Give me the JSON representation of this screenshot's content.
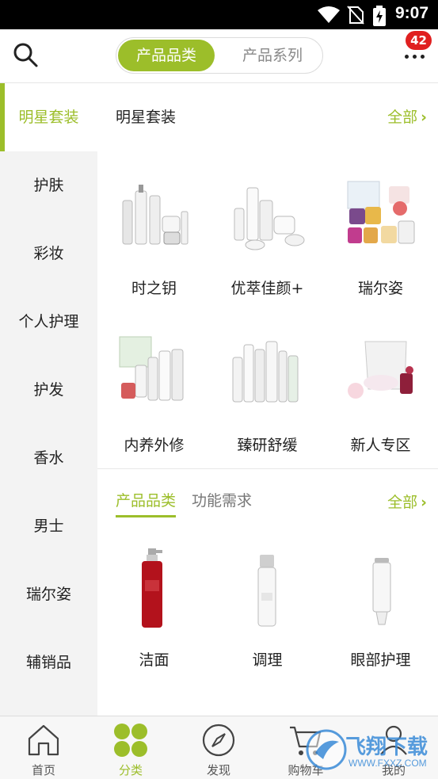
{
  "status_bar": {
    "time": "9:07"
  },
  "header": {
    "segments": {
      "active": "产品品类",
      "inactive": "产品系列"
    },
    "badge_count": "42"
  },
  "sidebar": {
    "items": [
      {
        "label": "明星套装",
        "active": true
      },
      {
        "label": "护肤"
      },
      {
        "label": "彩妆"
      },
      {
        "label": "个人护理"
      },
      {
        "label": "护发"
      },
      {
        "label": "香水"
      },
      {
        "label": "男士"
      },
      {
        "label": "瑞尔姿"
      },
      {
        "label": "辅销品"
      }
    ]
  },
  "main": {
    "section1": {
      "title": "明星套装",
      "all_label": "全部",
      "items": [
        {
          "label": "时之钥"
        },
        {
          "label": "优萃佳颜+"
        },
        {
          "label": "瑞尔姿"
        },
        {
          "label": "内养外修"
        },
        {
          "label": "臻研舒缓"
        },
        {
          "label": "新人专区"
        }
      ]
    },
    "section2": {
      "tabs": [
        "产品品类",
        "功能需求"
      ],
      "all_label": "全部",
      "items": [
        {
          "label": "洁面"
        },
        {
          "label": "调理"
        },
        {
          "label": "眼部护理"
        }
      ]
    }
  },
  "bottom_nav": {
    "items": [
      {
        "label": "首页",
        "icon": "home-icon"
      },
      {
        "label": "分类",
        "icon": "category-icon",
        "active": true
      },
      {
        "label": "发现",
        "icon": "compass-icon"
      },
      {
        "label": "购物车",
        "icon": "cart-icon"
      },
      {
        "label": "我的",
        "icon": "profile-icon"
      }
    ]
  },
  "watermark": {
    "text": "飞翔下载",
    "subtext": "WWW.FXXZ.COM"
  },
  "colors": {
    "accent": "#9cbe2a",
    "badge": "#e02020",
    "sidebar_bg": "#f3f3f3"
  }
}
